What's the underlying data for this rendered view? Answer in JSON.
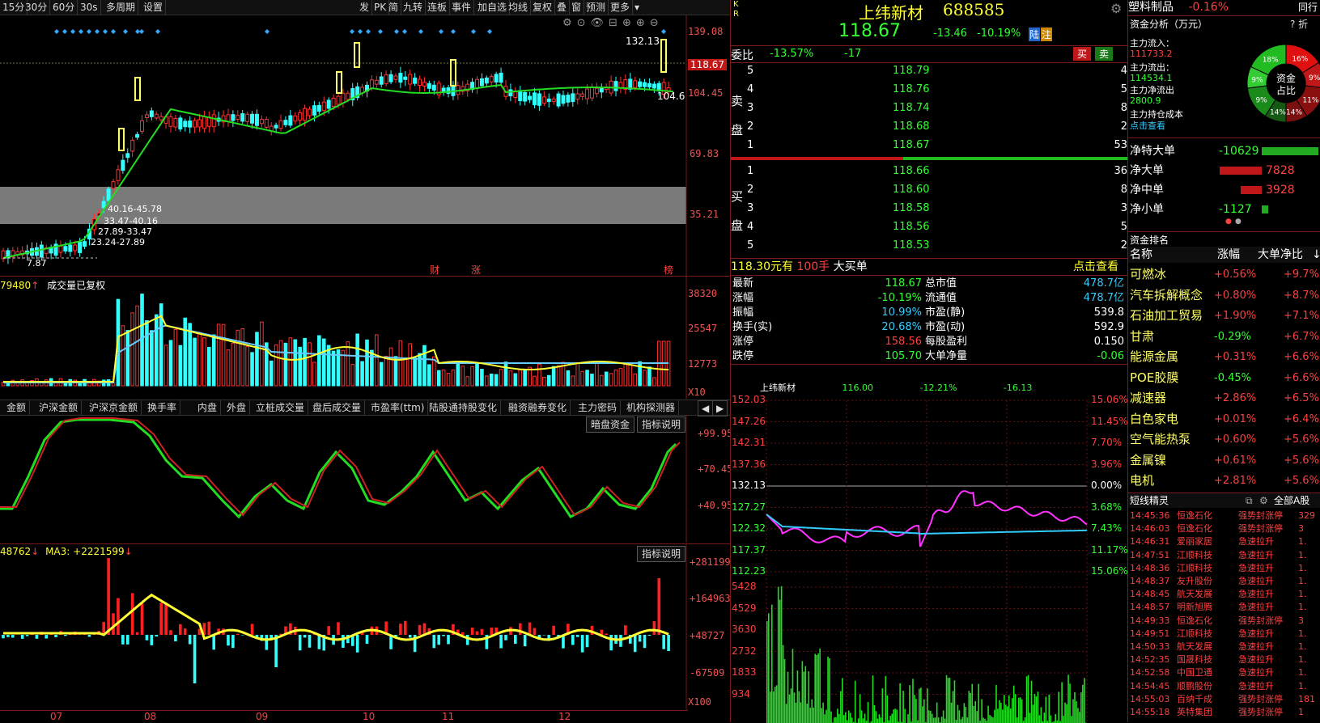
{
  "toolbar": {
    "items": [
      "15分",
      "30分",
      "60分",
      "30s",
      "多周期",
      "设置"
    ],
    "right_items": [
      "发",
      "PK",
      "简",
      "九转",
      "连板",
      "事件",
      "加自选",
      "均线",
      "复权",
      "叠",
      "窗",
      "预测",
      "更多"
    ]
  },
  "kline": {
    "price_axis": [
      "139.08",
      "104.45",
      "69.83",
      "35.21"
    ],
    "current_price_tag": "118.67",
    "last_close_line": "132.13",
    "marker_high": "132.13",
    "marker_low": "104.6",
    "min_price": "7.87",
    "zone_labels": [
      "40.16-45.78",
      "33.47-40.16",
      "27.89-33.47",
      "23.24-27.89"
    ],
    "events": [
      "财",
      "涨",
      "榜"
    ]
  },
  "volume": {
    "header_value": "79480",
    "header_label": "成交量已复权",
    "axis": [
      "38320",
      "25547",
      "12773"
    ],
    "unit": "X10"
  },
  "indicator_tabs": [
    "金额",
    "沪深金额",
    "沪深京金额",
    "换手率",
    "内盘",
    "外盘",
    "立桩成交量",
    "盘后成交量",
    "市盈率(ttm)",
    "陆股通持股变化",
    "融资融券变化",
    "主力密码",
    "机构探测器"
  ],
  "osc": {
    "buttons": [
      "暗盘资金",
      "指标说明"
    ],
    "axis": [
      "+99.95",
      "+70.45",
      "+40.95"
    ]
  },
  "flow": {
    "header": "48762",
    "ma_label": "MA3: +2221599",
    "button": "指标说明",
    "axis": [
      "+281199",
      "+164963",
      "+48727",
      "-67509"
    ],
    "unit": "X100"
  },
  "x_axis": [
    "07",
    "08",
    "09",
    "10",
    "11",
    "12"
  ],
  "stock": {
    "kr": "K R",
    "name": "上纬新材",
    "code": "688585",
    "price": "118.67",
    "change": "-13.46",
    "pct": "-10.19%",
    "tags": [
      "陆",
      "注"
    ],
    "webi_label": "委比",
    "webi_pct": "-13.57%",
    "webi_diff": "-17",
    "buy_btn": "买",
    "sell_btn": "卖"
  },
  "orderbook": {
    "sell_label": "卖盘",
    "buy_label": "买盘",
    "asks": [
      {
        "lvl": "5",
        "price": "118.79",
        "vol": "4"
      },
      {
        "lvl": "4",
        "price": "118.76",
        "vol": "5"
      },
      {
        "lvl": "3",
        "price": "118.74",
        "vol": "8"
      },
      {
        "lvl": "2",
        "price": "118.68",
        "vol": "2"
      },
      {
        "lvl": "1",
        "price": "118.67",
        "vol": "53"
      }
    ],
    "bids": [
      {
        "lvl": "1",
        "price": "118.66",
        "vol": "36"
      },
      {
        "lvl": "2",
        "price": "118.60",
        "vol": "8"
      },
      {
        "lvl": "3",
        "price": "118.58",
        "vol": "3"
      },
      {
        "lvl": "4",
        "price": "118.56",
        "vol": "5"
      },
      {
        "lvl": "5",
        "price": "118.53",
        "vol": "2"
      }
    ],
    "big_order": {
      "price": "118.30元有",
      "hands": "100手",
      "label": "大买单",
      "link": "点击查看"
    }
  },
  "quote": {
    "rows": [
      {
        "l1": "最新",
        "v1": "118.67",
        "l2": "总市值",
        "v2": "478.7亿"
      },
      {
        "l1": "涨幅",
        "v1": "-10.19%",
        "l2": "流通值",
        "v2": "478.7亿"
      },
      {
        "l1": "振幅",
        "v1": "10.99%",
        "l2": "市盈(静)",
        "v2": "539.8"
      },
      {
        "l1": "换手(实)",
        "v1": "20.68%",
        "l2": "市盈(动)",
        "v2": "592.9"
      },
      {
        "l1": "涨停",
        "v1": "158.56",
        "l2": "每股盈利",
        "v2": "0.150"
      },
      {
        "l1": "跌停",
        "v1": "105.70",
        "l2": "大单净量",
        "v2": "-0.06"
      }
    ]
  },
  "intraday": {
    "title": "上纬新材",
    "v1": "116.00",
    "v2": "-12.21%",
    "v3": "-16.13",
    "price_axis": [
      "152.03",
      "147.26",
      "142.31",
      "137.36",
      "132.13",
      "127.27",
      "122.32",
      "117.37",
      "112.23"
    ],
    "pct_axis": [
      "15.06%",
      "11.45%",
      "7.70%",
      "3.96%",
      "0.00%",
      "3.68%",
      "7.43%",
      "11.17%",
      "15.06%"
    ],
    "vol_axis": [
      "5428",
      "4529",
      "3630",
      "2732",
      "1833",
      "934"
    ]
  },
  "sector": {
    "name": "塑料制品",
    "pct": "-0.16%",
    "right": "同行"
  },
  "fund": {
    "title": "资金分析（万元）",
    "inflow_label": "主力流入：",
    "inflow": "111733.2",
    "outflow_label": "主力流出：",
    "outflow": "114534.1",
    "net_label": "主力净流出",
    "net": "2800.9",
    "hold_label": "主力持仓成本",
    "link": "点击查看",
    "donut_center": [
      "资金",
      "占比"
    ],
    "donut_pcts": [
      "18%",
      "16%",
      "9%",
      "11%",
      "14%",
      "14%",
      "9%",
      "9%"
    ]
  },
  "net_orders": [
    {
      "label": "净特大单",
      "value": "-10629",
      "color": "green",
      "frac": 1.0
    },
    {
      "label": "净大单",
      "value": "7828",
      "color": "red",
      "frac": 0.74
    },
    {
      "label": "净中单",
      "value": "3928",
      "color": "red",
      "frac": 0.37
    },
    {
      "label": "净小单",
      "value": "-1127",
      "color": "green",
      "frac": 0.11
    }
  ],
  "ranking": {
    "title": "资金排名",
    "headers": [
      "名称",
      "涨幅",
      "大单净比"
    ],
    "rows": [
      {
        "name": "可燃冰",
        "pct": "+0.56%",
        "ratio": "+9.7%"
      },
      {
        "name": "汽车拆解概念",
        "pct": "+0.80%",
        "ratio": "+8.7%"
      },
      {
        "name": "石油加工贸易",
        "pct": "+1.90%",
        "ratio": "+7.1%"
      },
      {
        "name": "甘肃",
        "pct": "-0.29%",
        "ratio": "+6.7%"
      },
      {
        "name": "能源金属",
        "pct": "+0.31%",
        "ratio": "+6.6%"
      },
      {
        "name": "POE胶膜",
        "pct": "-0.45%",
        "ratio": "+6.6%"
      },
      {
        "name": "减速器",
        "pct": "+2.86%",
        "ratio": "+6.5%"
      },
      {
        "name": "白色家电",
        "pct": "+0.01%",
        "ratio": "+6.4%"
      },
      {
        "name": "空气能热泵",
        "pct": "+0.60%",
        "ratio": "+5.6%"
      },
      {
        "name": "金属镍",
        "pct": "+0.61%",
        "ratio": "+5.6%"
      },
      {
        "name": "电机",
        "pct": "+2.81%",
        "ratio": "+5.6%"
      }
    ]
  },
  "news": {
    "title": "短线精灵",
    "filter": "全部A股",
    "rows": [
      {
        "time": "14:45:36",
        "name": "恒逸石化",
        "event": "强势封涨停",
        "val": "329"
      },
      {
        "time": "14:46:03",
        "name": "恒逸石化",
        "event": "强势封涨停",
        "val": "3"
      },
      {
        "time": "14:46:31",
        "name": "爱丽家居",
        "event": "急速拉升",
        "val": "1."
      },
      {
        "time": "14:47:51",
        "name": "江顺科技",
        "event": "急速拉升",
        "val": "1."
      },
      {
        "time": "14:48:36",
        "name": "江顺科技",
        "event": "急速拉升",
        "val": "1."
      },
      {
        "time": "14:48:37",
        "name": "友升股份",
        "event": "急速拉升",
        "val": "1."
      },
      {
        "time": "14:48:45",
        "name": "航天发展",
        "event": "急速拉升",
        "val": "1."
      },
      {
        "time": "14:48:57",
        "name": "明新旭腾",
        "event": "急速拉升",
        "val": "1."
      },
      {
        "time": "14:49:33",
        "name": "恒逸石化",
        "event": "强势封涨停",
        "val": "3"
      },
      {
        "time": "14:49:51",
        "name": "江顺科技",
        "event": "急速拉升",
        "val": "1."
      },
      {
        "time": "14:50:33",
        "name": "航天发展",
        "event": "急速拉升",
        "val": "1."
      },
      {
        "time": "14:52:35",
        "name": "国晟科技",
        "event": "急速拉升",
        "val": "1."
      },
      {
        "time": "14:52:58",
        "name": "中国卫通",
        "event": "急速拉升",
        "val": "1."
      },
      {
        "time": "14:54:45",
        "name": "顺鹏股份",
        "event": "急速拉升",
        "val": "1."
      },
      {
        "time": "14:55:03",
        "name": "百纳千成",
        "event": "强势封涨停",
        "val": "181"
      },
      {
        "time": "14:55:18",
        "name": "英特集团",
        "event": "强势封涨停",
        "val": "1"
      }
    ]
  },
  "colors": {
    "up": "#ff3030",
    "down": "#33ffff",
    "ma_green": "#22dd22",
    "yellow": "#ffff33",
    "bg": "#000000"
  }
}
